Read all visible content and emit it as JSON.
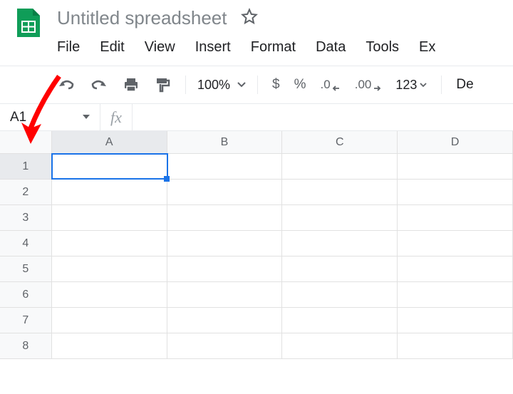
{
  "header": {
    "doc_title": "Untitled spreadsheet"
  },
  "menubar": {
    "items": [
      "File",
      "Edit",
      "View",
      "Insert",
      "Format",
      "Data",
      "Tools",
      "Ex"
    ]
  },
  "toolbar": {
    "zoom": "100%",
    "currency_symbol": "$",
    "percent_symbol": "%",
    "dec_decrease": ".0",
    "dec_increase": ".00",
    "more_formats": "123",
    "font_label": "De"
  },
  "formula_bar": {
    "name_box": "A1",
    "fx_label": "fx",
    "value": ""
  },
  "grid": {
    "columns": [
      "A",
      "B",
      "C",
      "D"
    ],
    "rows": [
      "1",
      "2",
      "3",
      "4",
      "5",
      "6",
      "7",
      "8"
    ],
    "active_cell": {
      "row": 0,
      "col": 0
    }
  }
}
